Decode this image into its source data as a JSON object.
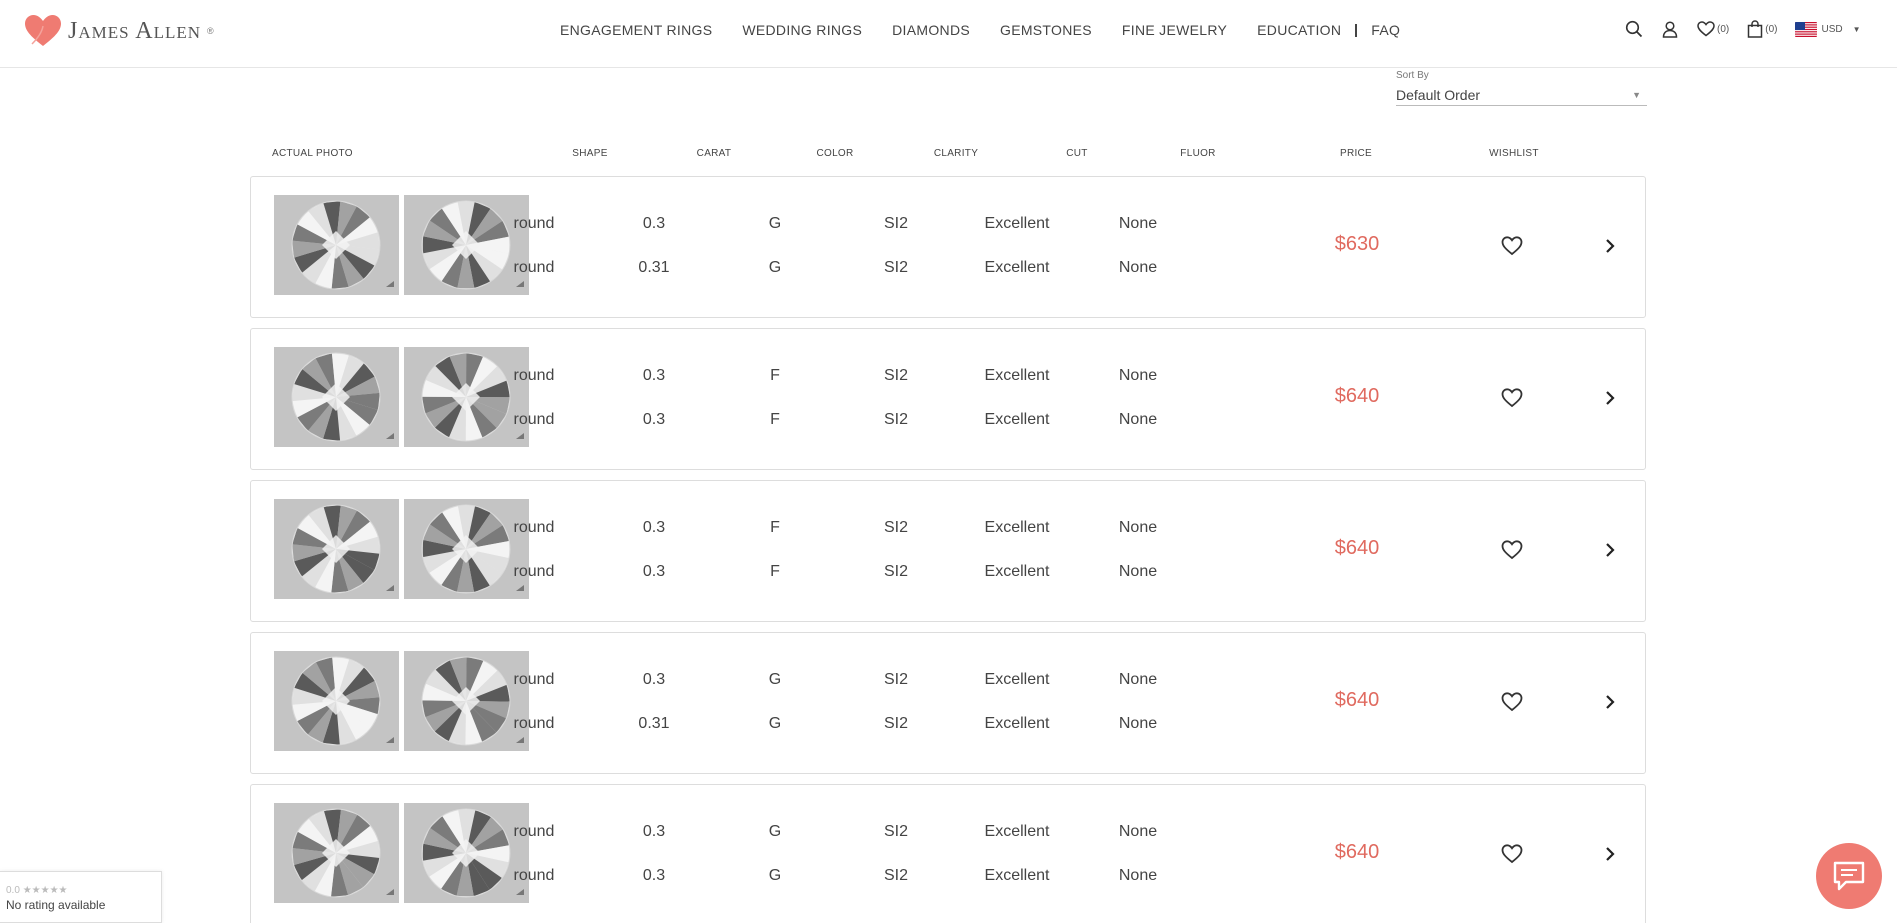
{
  "brand": {
    "name": "James Allen",
    "reg": "®",
    "accent": "#ef7b72"
  },
  "nav": [
    {
      "label": "ENGAGEMENT RINGS"
    },
    {
      "label": "WEDDING RINGS"
    },
    {
      "label": "DIAMONDS"
    },
    {
      "label": "GEMSTONES"
    },
    {
      "label": "FINE JEWELRY"
    },
    {
      "label": "EDUCATION"
    },
    {
      "label": "FAQ"
    }
  ],
  "header_icons": {
    "wishlist_count": "(0)",
    "cart_count": "(0)",
    "currency": "USD"
  },
  "sort": {
    "label": "Sort By",
    "value": "Default Order"
  },
  "columns": {
    "photo": "ACTUAL PHOTO",
    "shape": "SHAPE",
    "carat": "CARAT",
    "color": "COLOR",
    "clarity": "CLARITY",
    "cut": "CUT",
    "fluor": "FLUOR",
    "price": "PRICE",
    "wishlist": "WISHLIST"
  },
  "pairs": [
    {
      "price": "$630",
      "stones": [
        {
          "shape": "round",
          "carat": "0.3",
          "color": "G",
          "clarity": "SI2",
          "cut": "Excellent",
          "fluor": "None"
        },
        {
          "shape": "round",
          "carat": "0.31",
          "color": "G",
          "clarity": "SI2",
          "cut": "Excellent",
          "fluor": "None"
        }
      ]
    },
    {
      "price": "$640",
      "stones": [
        {
          "shape": "round",
          "carat": "0.3",
          "color": "F",
          "clarity": "SI2",
          "cut": "Excellent",
          "fluor": "None"
        },
        {
          "shape": "round",
          "carat": "0.3",
          "color": "F",
          "clarity": "SI2",
          "cut": "Excellent",
          "fluor": "None"
        }
      ]
    },
    {
      "price": "$640",
      "stones": [
        {
          "shape": "round",
          "carat": "0.3",
          "color": "F",
          "clarity": "SI2",
          "cut": "Excellent",
          "fluor": "None"
        },
        {
          "shape": "round",
          "carat": "0.3",
          "color": "F",
          "clarity": "SI2",
          "cut": "Excellent",
          "fluor": "None"
        }
      ]
    },
    {
      "price": "$640",
      "stones": [
        {
          "shape": "round",
          "carat": "0.3",
          "color": "G",
          "clarity": "SI2",
          "cut": "Excellent",
          "fluor": "None"
        },
        {
          "shape": "round",
          "carat": "0.31",
          "color": "G",
          "clarity": "SI2",
          "cut": "Excellent",
          "fluor": "None"
        }
      ]
    },
    {
      "price": "$640",
      "stones": [
        {
          "shape": "round",
          "carat": "0.3",
          "color": "G",
          "clarity": "SI2",
          "cut": "Excellent",
          "fluor": "None"
        },
        {
          "shape": "round",
          "carat": "0.3",
          "color": "G",
          "clarity": "SI2",
          "cut": "Excellent",
          "fluor": "None"
        }
      ]
    }
  ],
  "rating_widget": {
    "score": "0.0",
    "stars": "★★★★★",
    "text": "No rating available"
  },
  "chat": {
    "icon": "chat-bubble-icon"
  }
}
